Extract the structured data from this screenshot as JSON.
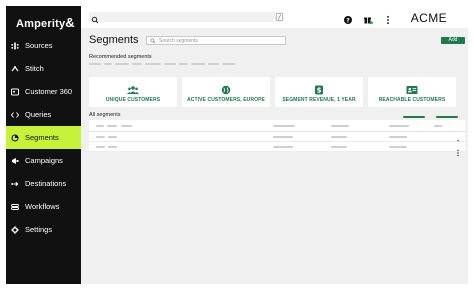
{
  "brand": {
    "name": "Amperity",
    "mark": "&"
  },
  "sidebar": {
    "items": [
      {
        "label": "Sources",
        "icon": "sources-icon"
      },
      {
        "label": "Stitch",
        "icon": "stitch-icon"
      },
      {
        "label": "Customer 360",
        "icon": "customer-360-icon"
      },
      {
        "label": "Queries",
        "icon": "queries-icon"
      },
      {
        "label": "Segments",
        "icon": "segments-icon",
        "active": true
      },
      {
        "label": "Campaigns",
        "icon": "campaigns-icon"
      },
      {
        "label": "Destinations",
        "icon": "destinations-icon"
      },
      {
        "label": "Workflows",
        "icon": "workflows-icon"
      },
      {
        "label": "Settings",
        "icon": "settings-icon"
      }
    ]
  },
  "topbar": {
    "search_shortcut": "/",
    "tenant": "ACME"
  },
  "main": {
    "title": "Segments",
    "search_placeholder": "Search segments",
    "add_label": "Add",
    "recommended_label": "Recommended segments",
    "cards": [
      {
        "label": "UNIQUE CUSTOMERS",
        "icon": "people-icon"
      },
      {
        "label": "ACTIVE CUSTOMERS, EUROPE",
        "icon": "globe-icon"
      },
      {
        "label": "SEGMENT REVENUE, 1 YEAR",
        "icon": "money-icon"
      },
      {
        "label": "REACHABLE CUSTOMERS",
        "icon": "contact-card-icon"
      }
    ],
    "all_label": "All segments"
  },
  "colors": {
    "sidebar_bg": "#111111",
    "active_nav": "#c7f23a",
    "accent_green": "#1e7a4f",
    "content_bg": "#f0f0f0"
  }
}
